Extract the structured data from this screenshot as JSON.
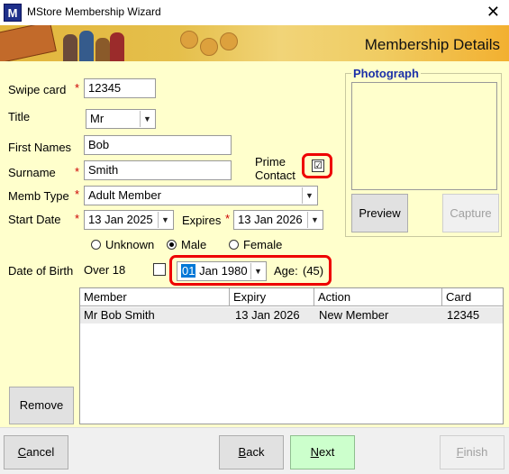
{
  "window": {
    "app_icon": "M",
    "title": "MStore Membership Wizard",
    "close_glyph": "✕"
  },
  "banner": {
    "title": "Membership Details"
  },
  "form": {
    "swipe_card": {
      "label": "Swipe card",
      "value": "12345"
    },
    "title": {
      "label": "Title",
      "value": "Mr"
    },
    "first_names": {
      "label": "First Names",
      "value": "Bob"
    },
    "surname": {
      "label": "Surname",
      "value": "Smith"
    },
    "prime_contact": {
      "label_line1": "Prime",
      "label_line2": "Contact",
      "checked": true,
      "check_glyph": "☑"
    },
    "memb_type": {
      "label": "Memb Type",
      "value": "Adult Member"
    },
    "start_date": {
      "label": "Start Date",
      "value": "13 Jan  2025"
    },
    "expires": {
      "label": "Expires",
      "value": "13 Jan  2026"
    },
    "gender": {
      "options": [
        "Unknown",
        "Male",
        "Female"
      ],
      "selected": "Male"
    },
    "dob": {
      "label": "Date of Birth",
      "over18_label": "Over 18",
      "over18_checked": false,
      "day": "01",
      "month_year": " Jan  1980",
      "age_label": "Age:",
      "age_value": "(45)"
    },
    "required_mark": "*"
  },
  "photograph": {
    "title": "Photograph",
    "preview_label": "Preview",
    "capture_label": "Capture"
  },
  "members_table": {
    "columns": [
      "Member",
      "Expiry",
      "Action",
      "Card"
    ],
    "rows": [
      {
        "member": "Mr Bob Smith",
        "expiry": "13 Jan 2026",
        "action": "New Member",
        "card": "12345"
      }
    ]
  },
  "buttons": {
    "remove": "Remove",
    "cancel_u": "C",
    "cancel_rest": "ancel",
    "back_u": "B",
    "back_rest": "ack",
    "next_u": "N",
    "next_rest": "ext",
    "finish_u": "F",
    "finish_rest": "inish"
  },
  "colors": {
    "form_bg": "#ffffcc",
    "group_title": "#1b2fa8",
    "highlight": "#e00000",
    "next_bg": "#ccffcc",
    "required": "#cc0000"
  },
  "icons": {
    "dropdown": "▼",
    "app": "mstore-logo-icon",
    "close": "close-icon"
  }
}
